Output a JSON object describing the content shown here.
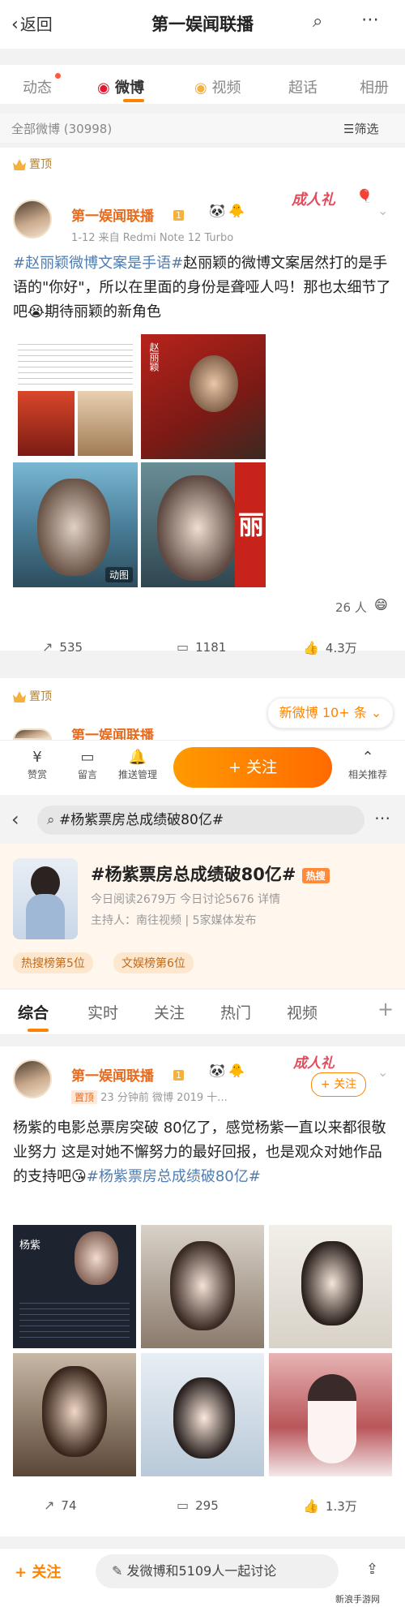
{
  "screen1": {
    "nav": {
      "back_label": "返回",
      "title": "第一娱闻联播"
    },
    "tabs": [
      "动态",
      "微博",
      "视频",
      "超话",
      "相册"
    ],
    "filter": {
      "count_label": "全部微博 (30998)",
      "filter_label": "筛选"
    },
    "pinned_label": "置顶",
    "post": {
      "username": "第一娱闻联播",
      "level": "1",
      "meta": "1-12  来自 Redmi Note 12 Turbo",
      "sticker": "成人礼",
      "text_topic1": "#赵丽颖微博文案是手语#",
      "text_body": "赵丽颖的微博文案居然打的是手语的\"你好\"，所以在里面的身份是聋哑人吗！那也太细节了吧😭期待丽颖的新角色",
      "image_tag": "动图",
      "image_text_poster": "赵丽颖",
      "image_text_banner": "丽",
      "viewers": "26 人",
      "shares": "535",
      "comments": "1181",
      "likes": "4.3万"
    },
    "pinned2_label": "置顶",
    "new_posts_pill": "新微博 10+ 条",
    "partial_name": "第一娱闻联播",
    "bottom": {
      "items": [
        "赞赏",
        "留言",
        "推送管理",
        "相关推荐"
      ],
      "follow_label": "+ 关注"
    }
  },
  "screen2": {
    "search_text": "#杨紫票房总成绩破80亿#",
    "topic_title": "#杨紫票房总成绩破80亿#",
    "hot_badge": "热搜",
    "stats": "今日阅读2679万  今日讨论5676  详情",
    "host": "主持人：南往视频 | 5家媒体发布",
    "rank1": "热搜榜第5位",
    "rank2": "文娱榜第6位",
    "tabs": [
      "综合",
      "实时",
      "关注",
      "热门",
      "视频"
    ],
    "post": {
      "username": "第一娱闻联播",
      "level": "1",
      "top_tag": "置顶",
      "meta": "23 分钟前  微博 2019 十...",
      "sticker": "成人礼",
      "follow": "+ 关注",
      "text_body": "杨紫的电影总票房突破 80亿了，感觉杨紫一直以来都很敬业努力 这是对她不懈努力的最好回报，也是观众对她作品的支持吧😘",
      "text_topic": "#杨紫票房总成绩破80亿#",
      "profile_name": "杨紫",
      "shares": "74",
      "comments": "295",
      "likes": "1.3万"
    },
    "bottom": {
      "follow_label": "+ 关注",
      "input_label": "发微博和5109人一起讨论"
    },
    "watermark": "新浪手游网"
  },
  "colors": {
    "accent": "#ff8200",
    "topic": "#507daf",
    "username": "#e86a1c"
  }
}
